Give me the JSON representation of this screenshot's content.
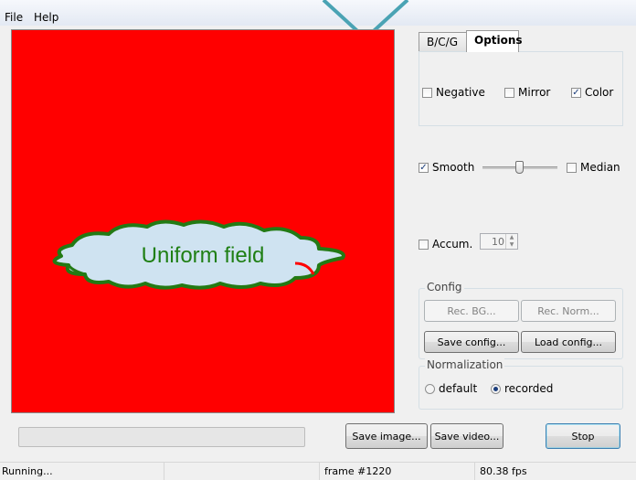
{
  "menu": {
    "file": "File",
    "help": "Help"
  },
  "viewer": {
    "annotation": "Uniform field",
    "background": "#ff0000",
    "annotation_color": "#1f7f14"
  },
  "tabs": [
    "B/C/G",
    "Options"
  ],
  "options": {
    "negative": "Negative",
    "mirror": "Mirror",
    "color": "Color",
    "smooth": "Smooth",
    "median": "Median",
    "accum": "Accum.",
    "accum_value": "10"
  },
  "checked": {
    "negative": false,
    "mirror": false,
    "color": true,
    "smooth": true,
    "median": false,
    "accum": false
  },
  "config": {
    "label": "Config",
    "rec_bg": "Rec. BG...",
    "rec_norm": "Rec. Norm...",
    "save": "Save config...",
    "load": "Load config..."
  },
  "normalization": {
    "label": "Normalization",
    "default": "default",
    "recorded": "recorded",
    "selected": "recorded"
  },
  "buttons": {
    "save_image": "Save image...",
    "save_video": "Save video...",
    "stop": "Stop"
  },
  "status": {
    "state": "Running...",
    "frame": "frame #1220",
    "fps": "80.38 fps"
  }
}
